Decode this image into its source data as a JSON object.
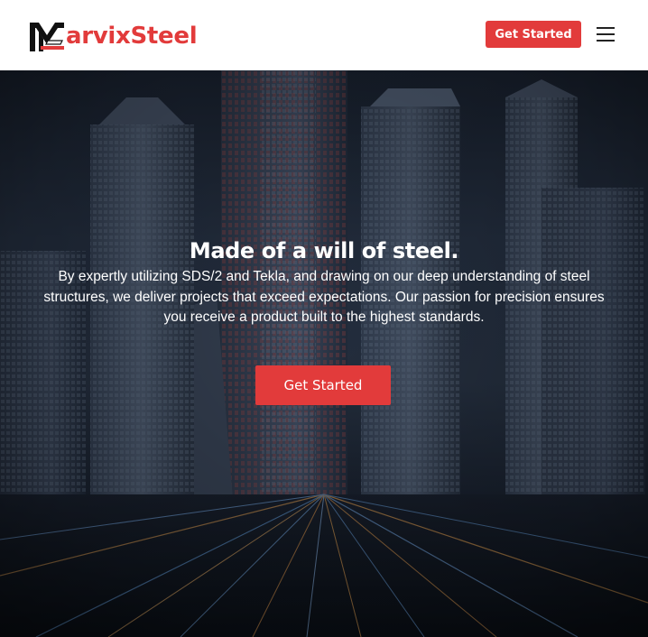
{
  "header": {
    "logo_text": "arvixSteel",
    "logo_icon": "m-beam-logo-icon",
    "cta_label": "Get Started",
    "menu_icon": "hamburger-menu-icon"
  },
  "hero": {
    "title": "Made of a will of steel.",
    "description": "By expertly utilizing SDS/2 and Tekla, and drawing on our deep understanding of steel structures, we deliver projects that exceed expectations. Our passion for precision ensures you receive a product built to the highest standards.",
    "cta_label": "Get Started",
    "background_image": "city-skyscrapers-night"
  },
  "colors": {
    "accent": "#e23b3b",
    "header_bg": "#ffffff",
    "hero_text": "#ffffff"
  }
}
